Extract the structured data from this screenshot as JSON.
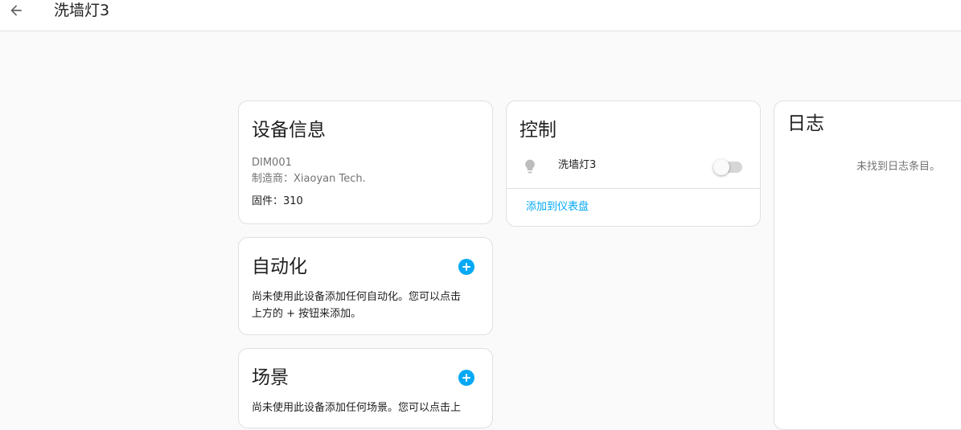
{
  "header": {
    "title": "洗墙灯3",
    "back_icon": "arrow-left-icon"
  },
  "device_info": {
    "title": "设备信息",
    "model": "DIM001",
    "manufacturer_label": "制造商：",
    "manufacturer": "Xiaoyan Tech.",
    "firmware_label": "固件：",
    "firmware": "310"
  },
  "automation": {
    "title": "自动化",
    "description_line1": "尚未使用此设备添加任何自动化。您可以点击",
    "description_line2": "上方的 + 按钮来添加。",
    "add_icon": "plus-circle-icon"
  },
  "scene": {
    "title": "场景",
    "description_line1": "尚未使用此设备添加任何场景。您可以点击上",
    "add_icon": "plus-circle-icon"
  },
  "control": {
    "title": "控制",
    "entity_name": "洗墙灯3",
    "entity_icon": "lightbulb-icon",
    "toggle_state": "off",
    "add_to_dashboard": "添加到仪表盘"
  },
  "logbook": {
    "title": "日志",
    "empty_text": "未找到日志条目。"
  },
  "colors": {
    "accent": "#03a9f4",
    "background": "#fafafa",
    "card": "#ffffff",
    "secondary_text": "#727272"
  }
}
